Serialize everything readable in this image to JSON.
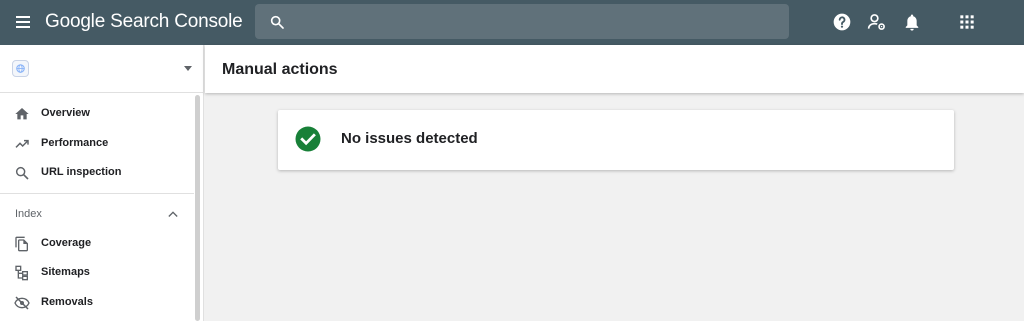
{
  "app": {
    "title": "Google Search Console"
  },
  "search": {
    "placeholder": "",
    "value": ""
  },
  "topbar_icons": [
    "help-icon",
    "account-settings-icon",
    "notifications-bell-icon",
    "apps-grid-icon"
  ],
  "sidebar": {
    "property": {
      "name": "",
      "icon": "globe-icon"
    },
    "items": [
      {
        "label": "Overview",
        "icon": "home-icon"
      },
      {
        "label": "Performance",
        "icon": "trending-up-icon"
      },
      {
        "label": "URL inspection",
        "icon": "search-icon"
      }
    ],
    "index_section": {
      "label": "Index",
      "expanded": true,
      "items": [
        {
          "label": "Coverage",
          "icon": "coverage-icon"
        },
        {
          "label": "Sitemaps",
          "icon": "sitemap-icon"
        },
        {
          "label": "Removals",
          "icon": "visibility-off-icon"
        }
      ]
    }
  },
  "main": {
    "title": "Manual actions",
    "status": {
      "text": "No issues detected",
      "icon": "check-circle-icon",
      "color": "#188038"
    }
  },
  "colors": {
    "topbar": "#455a64",
    "search_bg": "#60717a",
    "background": "#f1f1f1"
  }
}
